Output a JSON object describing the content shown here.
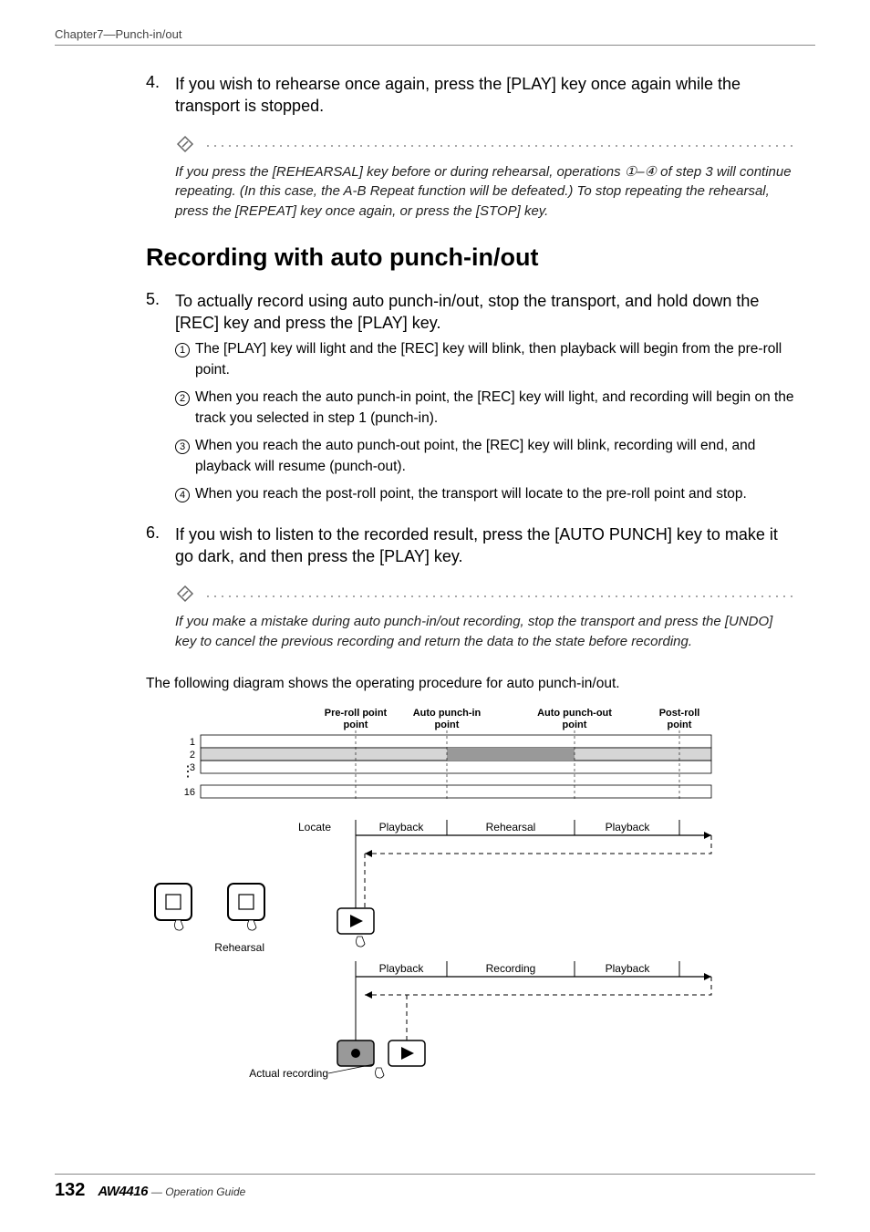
{
  "header": {
    "chapter": "Chapter7—Punch-in/out"
  },
  "step4": {
    "num": "4.",
    "head": "If you wish to rehearse once again, press the [PLAY] key once again while the transport is stopped."
  },
  "note1": "If you press the [REHEARSAL] key before or during rehearsal, operations ①–④ of step 3 will continue repeating. (In this case, the A-B Repeat function will be defeated.) To stop repeating the rehearsal, press the [REPEAT] key once again, or press the [STOP] key.",
  "section_title": "Recording with auto punch-in/out",
  "step5": {
    "num": "5.",
    "head": "To actually record using auto punch-in/out, stop the transport, and hold down the [REC] key and press the [PLAY] key.",
    "items": [
      "The [PLAY] key will light and the [REC] key will blink, then playback will begin from the pre-roll point.",
      "When you reach the auto punch-in point, the [REC] key will light, and recording will begin on the track you selected in step 1 (punch-in).",
      "When you reach the auto punch-out point, the [REC] key will blink, recording will end, and playback will resume (punch-out).",
      "When you reach the post-roll point, the transport will locate to the pre-roll point and stop."
    ]
  },
  "step6": {
    "num": "6.",
    "head": "If you wish to listen to the recorded result, press the [AUTO PUNCH] key to make it go dark, and then press the [PLAY] key."
  },
  "note2": "If you make a mistake during auto punch-in/out recording, stop the transport and press the [UNDO] key to cancel the previous recording and return the data to the state before recording.",
  "diagram_intro": "The following diagram shows the operating procedure for auto punch-in/out.",
  "chart_data": {
    "type": "diagram",
    "points": {
      "preroll": "Pre-roll point",
      "punchin": "Auto punch-in point",
      "punchout": "Auto punch-out point",
      "postroll": "Post-roll point"
    },
    "tracks": [
      "1",
      "2",
      "3",
      "⋮",
      "16"
    ],
    "row_rehearsal": {
      "segments": [
        "Locate",
        "Playback",
        "Rehearsal",
        "Playback"
      ],
      "button_label": "Rehearsal"
    },
    "row_recording": {
      "segments": [
        "Playback",
        "Recording",
        "Playback"
      ],
      "button_label": "Actual recording"
    }
  },
  "footer": {
    "page": "132",
    "product": "AW4416",
    "guide": "— Operation Guide"
  }
}
